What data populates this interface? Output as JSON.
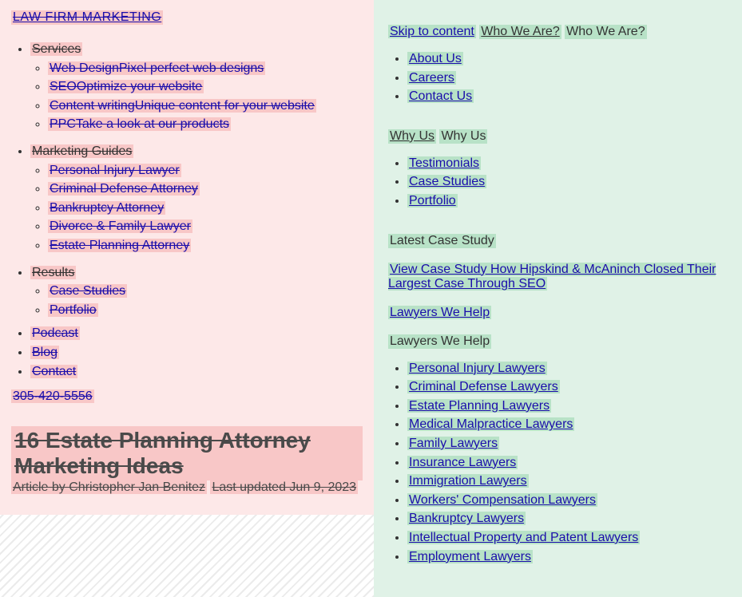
{
  "left": {
    "brand": "LAW FIRM MARKETING",
    "nav": {
      "items": [
        {
          "label": "Services",
          "children": [
            {
              "label": "Web Design",
              "sub": "Pixel perfect web designs"
            },
            {
              "label": "SEO",
              "sub": "Optimize your website"
            },
            {
              "label": "Content writing",
              "sub": "Unique content for your website"
            },
            {
              "label": "PPC",
              "sub": "Take a look at our products"
            }
          ]
        },
        {
          "label": "Marketing Guides",
          "children": [
            {
              "label": "Personal Injury Lawyer"
            },
            {
              "label": "Criminal Defense Attorney"
            },
            {
              "label": "Bankruptcy Attorney"
            },
            {
              "label": "Divorce & Family Lawyer"
            },
            {
              "label": "Estate Planning Attorney"
            }
          ]
        },
        {
          "label": "Results",
          "children": [
            {
              "label": "Case Studies"
            },
            {
              "label": "Portfolio"
            }
          ]
        },
        {
          "label": "Podcast"
        },
        {
          "label": "Blog"
        },
        {
          "label": "Contact"
        }
      ]
    },
    "phone": "305-420-5556",
    "title": "16 Estate Planning Attorney Marketing Ideas",
    "author_line": "Article by Christopher Jan Benitez",
    "updated_line": "Last updated Jun 9, 2023"
  },
  "right": {
    "skip": "Skip to content",
    "sections": [
      {
        "link": "Who We Are?",
        "heading": "Who We Are?",
        "items": [
          "About Us",
          "Careers",
          "Contact Us"
        ]
      },
      {
        "link": "Why Us",
        "heading": "Why Us",
        "items": [
          "Testimonials",
          "Case Studies",
          "Portfolio"
        ]
      }
    ],
    "latest_case": {
      "heading": "Latest Case Study",
      "link": "View Case Study How Hipskind & McAninch Closed Their Largest Case Through SEO"
    },
    "lawyers": {
      "link": "Lawyers We Help",
      "heading": "Lawyers We Help",
      "items": [
        "Personal Injury Lawyers",
        "Criminal Defense Lawyers",
        "Estate Planning Lawyers",
        "Medical Malpractice Lawyers",
        "Family Lawyers",
        "Insurance Lawyers",
        "Immigration Lawyers",
        "Workers' Compensation Lawyers",
        "Bankruptcy Lawyers",
        "Intellectual Property and Patent Lawyers",
        "Employment Lawyers"
      ]
    }
  }
}
